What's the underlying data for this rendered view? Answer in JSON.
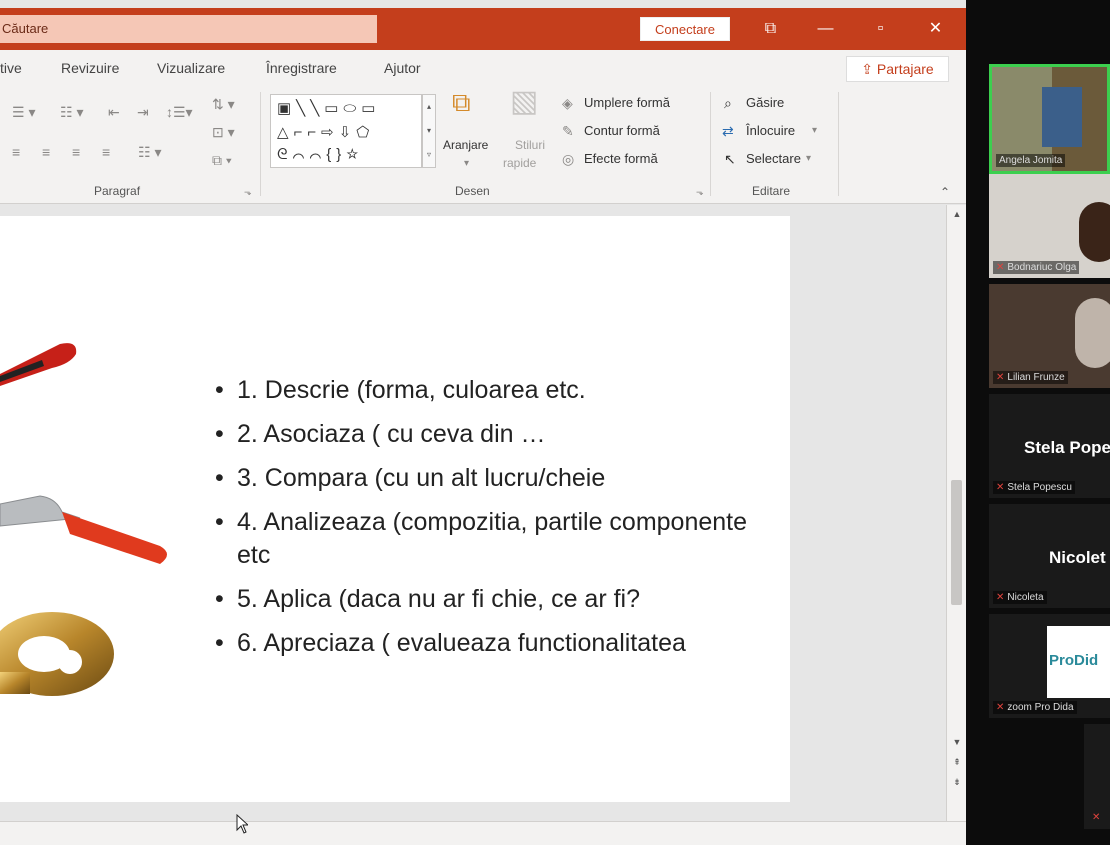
{
  "titlebar": {
    "search_text": "Căutare",
    "connect_label": "Conectare",
    "restore_icon": "⧉",
    "minimize_icon": "—",
    "maximize_icon": "▫",
    "close_icon": "✕"
  },
  "tabs": [
    {
      "label": "tive"
    },
    {
      "label": "Revizuire"
    },
    {
      "label": "Vizualizare"
    },
    {
      "label": "Înregistrare"
    },
    {
      "label": "Ajutor"
    }
  ],
  "share_label": "Partajare",
  "ribbon": {
    "paragraph_label": "Paragraf",
    "drawing_label": "Desen",
    "editing_label": "Editare",
    "arrange_label": "Aranjare",
    "quick_styles_line1": "Stiluri",
    "quick_styles_line2": "rapide",
    "shape_fill": "Umplere formă",
    "shape_outline": "Contur formă",
    "shape_effects": "Efecte formă",
    "find": "Găsire",
    "replace": "Înlocuire",
    "select": "Selectare"
  },
  "slide": {
    "bullets": [
      "1. Descrie (forma, culoarea etc.",
      "2. Asociaza ( cu ceva din …",
      "3. Compara (cu un alt lucru/cheie",
      "4. Analizeaza (compozitia, partile componente etc",
      "5. Aplica (daca nu ar fi chie, ce ar fi?",
      "6. Apreciaza ( evalueaza functionalitatea"
    ]
  },
  "participants": [
    {
      "name": "Angela Jomita",
      "big": ""
    },
    {
      "name": "Bodnariuc Olga",
      "big": ""
    },
    {
      "name": "Lilian Frunze",
      "big": ""
    },
    {
      "name": "Stela Popescu",
      "big": "Stela Pope"
    },
    {
      "name": "Nicoleta",
      "big": "Nicolet"
    },
    {
      "name": "zoom Pro Dida",
      "big": ""
    }
  ],
  "colors": {
    "accent": "#c43e1c",
    "active_speaker": "#3ccf4e"
  }
}
